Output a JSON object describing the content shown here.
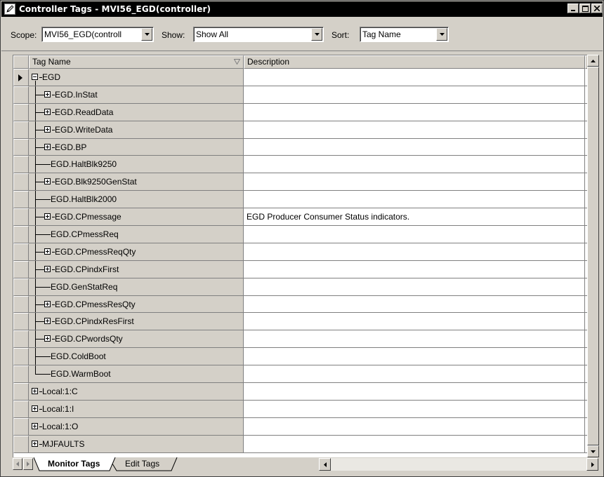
{
  "window": {
    "title": "Controller Tags - MVI56_EGD(controller)"
  },
  "toolbar": {
    "scope_label": "Scope:",
    "scope_value": "MVI56_EGD(controll",
    "show_label": "Show:",
    "show_value": "Show All",
    "sort_label": "Sort:",
    "sort_value": "Tag Name"
  },
  "grid": {
    "columns": [
      "Tag Name",
      "Description"
    ],
    "rows": [
      {
        "name": "EGD",
        "description": "",
        "level": 0,
        "expander": "minus",
        "current": true
      },
      {
        "name": "EGD.InStat",
        "description": "",
        "level": 1,
        "expander": "plus"
      },
      {
        "name": "EGD.ReadData",
        "description": "",
        "level": 1,
        "expander": "plus"
      },
      {
        "name": "EGD.WriteData",
        "description": "",
        "level": 1,
        "expander": "plus"
      },
      {
        "name": "EGD.BP",
        "description": "",
        "level": 1,
        "expander": "plus"
      },
      {
        "name": "EGD.HaltBlk9250",
        "description": "",
        "level": 1,
        "expander": "none"
      },
      {
        "name": "EGD.Blk9250GenStat",
        "description": "",
        "level": 1,
        "expander": "plus"
      },
      {
        "name": "EGD.HaltBlk2000",
        "description": "",
        "level": 1,
        "expander": "none"
      },
      {
        "name": "EGD.CPmessage",
        "description": "EGD Producer Consumer Status indicators.",
        "level": 1,
        "expander": "plus"
      },
      {
        "name": "EGD.CPmessReq",
        "description": "",
        "level": 1,
        "expander": "none"
      },
      {
        "name": "EGD.CPmessReqQty",
        "description": "",
        "level": 1,
        "expander": "plus"
      },
      {
        "name": "EGD.CPindxFirst",
        "description": "",
        "level": 1,
        "expander": "plus"
      },
      {
        "name": "EGD.GenStatReq",
        "description": "",
        "level": 1,
        "expander": "none"
      },
      {
        "name": "EGD.CPmessResQty",
        "description": "",
        "level": 1,
        "expander": "plus"
      },
      {
        "name": "EGD.CPindxResFirst",
        "description": "",
        "level": 1,
        "expander": "plus"
      },
      {
        "name": "EGD.CPwordsQty",
        "description": "",
        "level": 1,
        "expander": "plus"
      },
      {
        "name": "EGD.ColdBoot",
        "description": "",
        "level": 1,
        "expander": "none"
      },
      {
        "name": "EGD.WarmBoot",
        "description": "",
        "level": 1,
        "expander": "none",
        "last": true
      },
      {
        "name": "Local:1:C",
        "description": "",
        "level": 0,
        "expander": "plus"
      },
      {
        "name": "Local:1:I",
        "description": "",
        "level": 0,
        "expander": "plus"
      },
      {
        "name": "Local:1:O",
        "description": "",
        "level": 0,
        "expander": "plus"
      },
      {
        "name": "MJFAULTS",
        "description": "",
        "level": 0,
        "expander": "plus"
      }
    ]
  },
  "tabs": {
    "monitor": "Monitor Tags",
    "edit": "Edit Tags"
  }
}
